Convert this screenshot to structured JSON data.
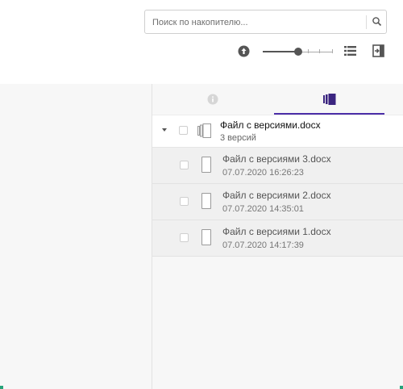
{
  "search": {
    "placeholder": "Поиск по накопителю...",
    "value": "",
    "icon": "search-icon"
  },
  "toolbar": {
    "upload_icon": "upload-icon",
    "zoom_level": 0.5,
    "list_view_icon": "list-view-icon",
    "exit_icon": "exit-icon"
  },
  "tabs": [
    {
      "id": "info",
      "icon": "info-icon",
      "active": false
    },
    {
      "id": "versions",
      "icon": "versions-icon",
      "active": true
    }
  ],
  "file": {
    "name": "Файл с версиями.docx",
    "versions_count": "3 версий"
  },
  "versions": [
    {
      "name": "Файл с версиями 3.docx",
      "date": "07.07.2020 16:26:23"
    },
    {
      "name": "Файл с версиями 2.docx",
      "date": "07.07.2020 14:35:01"
    },
    {
      "name": "Файл с версиями 1.docx",
      "date": "07.07.2020 14:17:39"
    }
  ],
  "colors": {
    "accent": "#4b2ea8",
    "corner_accent": "#27a37a"
  }
}
